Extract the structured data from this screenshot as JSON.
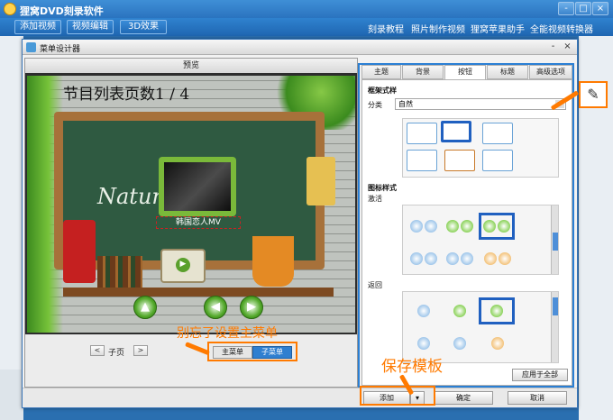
{
  "app": {
    "title": "狸窝DVD刻录软件"
  },
  "toolbar": {
    "buttons": [
      "添加视频",
      "视频编辑",
      "3D效果"
    ],
    "links": [
      "刻录教程",
      "照片制作视频",
      "狸窝苹果助手",
      "全能视频转换器"
    ]
  },
  "window_controls": [
    "-",
    "□",
    "×"
  ],
  "dialog": {
    "title": "菜单设计器",
    "controls": [
      "-",
      "×"
    ],
    "preview_label": "预览",
    "menu_count_label": "节目列表页数1 / 4",
    "nature_text": "Nature",
    "item_label": "韩国恋人MV",
    "pager": {
      "prev": "<",
      "label": "子页",
      "next": ">"
    },
    "menu_tabs": [
      "主菜单",
      "子菜单"
    ],
    "hint_text": "别忘了设置主菜单",
    "save_hint": "保存模板"
  },
  "right_panel": {
    "tabs": [
      "主题",
      "背景",
      "按钮",
      "标题",
      "高级选项"
    ],
    "active_tab": 2,
    "frame_section": "框架式样",
    "category_label": "分类",
    "category_value": "自然",
    "icon_section": "图标样式",
    "activate_label": "激活",
    "return_label": "返回",
    "apply_all": "应用于全部"
  },
  "footer": {
    "add": "添加",
    "ok": "确定",
    "cancel": "取消"
  },
  "colors": {
    "accent": "#2a7fd4",
    "highlight": "#ff7a00",
    "selected": "#2060c0"
  },
  "icons": [
    "app-icon",
    "dialog-icon",
    "edit-icon",
    "play-icon",
    "left-arrow-icon",
    "right-arrow-icon",
    "home-icon"
  ]
}
